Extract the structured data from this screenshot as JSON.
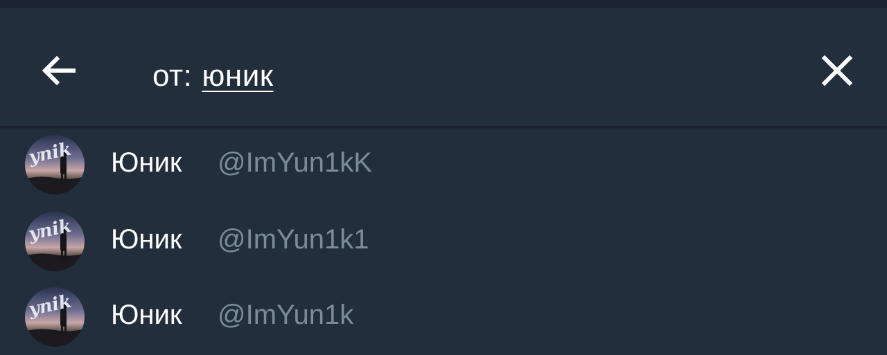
{
  "search": {
    "prefix": "от:",
    "term": "юник"
  },
  "icons": {
    "back": "arrow-left-icon",
    "close": "close-icon",
    "avatar_watermark": "ynik"
  },
  "colors": {
    "background": "#232e3c",
    "header_background": "#232e3c",
    "name_text": "#ffffff",
    "username_text": "#7d8b99"
  },
  "results": [
    {
      "name": "Юник",
      "username": "@ImYun1kK"
    },
    {
      "name": "Юник",
      "username": "@ImYun1k1"
    },
    {
      "name": "Юник",
      "username": "@ImYun1k"
    }
  ]
}
